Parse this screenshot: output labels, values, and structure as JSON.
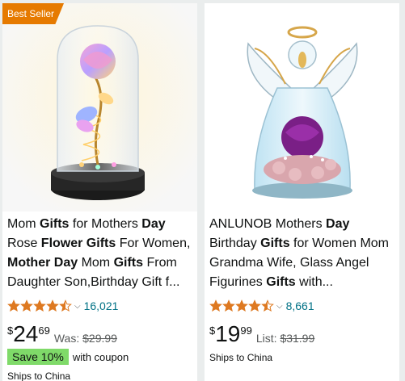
{
  "products": [
    {
      "badge": "Best Seller",
      "title_parts": [
        {
          "t": "Mom ",
          "b": false
        },
        {
          "t": "Gifts",
          "b": true
        },
        {
          "t": " for Mothers ",
          "b": false
        },
        {
          "t": "Day",
          "b": true
        },
        {
          "t": " Rose ",
          "b": false
        },
        {
          "t": "Flower Gifts",
          "b": true
        },
        {
          "t": " For Women, ",
          "b": false
        },
        {
          "t": "Mother Day",
          "b": true
        },
        {
          "t": " Mom ",
          "b": false
        },
        {
          "t": "Gifts",
          "b": true
        },
        {
          "t": " From Daughter Son,Birthday Gift f...",
          "b": false
        }
      ],
      "rating": 4.5,
      "review_count": "16,021",
      "currency": "$",
      "price_whole": "24",
      "price_fraction": "69",
      "was_label": "Was:",
      "was_price": "$29.99",
      "save_badge": "Save 10%",
      "coupon_text": "with coupon",
      "shipping": "Ships to China"
    },
    {
      "badge": "",
      "title_parts": [
        {
          "t": "ANLUNOB Mothers ",
          "b": false
        },
        {
          "t": "Day",
          "b": true
        },
        {
          "t": " Birthday ",
          "b": false
        },
        {
          "t": "Gifts",
          "b": true
        },
        {
          "t": " for Women Mom Grandma Wife, Glass Angel Figurines ",
          "b": false
        },
        {
          "t": "Gifts",
          "b": true
        },
        {
          "t": " with...",
          "b": false
        }
      ],
      "rating": 4.5,
      "review_count": "8,661",
      "currency": "$",
      "price_whole": "19",
      "price_fraction": "99",
      "was_label": "List:",
      "was_price": "$31.99",
      "save_badge": "",
      "coupon_text": "",
      "shipping": "Ships to China"
    }
  ],
  "colors": {
    "badge_bg": "#e67a00",
    "star": "#de7921",
    "link": "#007185",
    "save_bg": "#7fda69"
  }
}
